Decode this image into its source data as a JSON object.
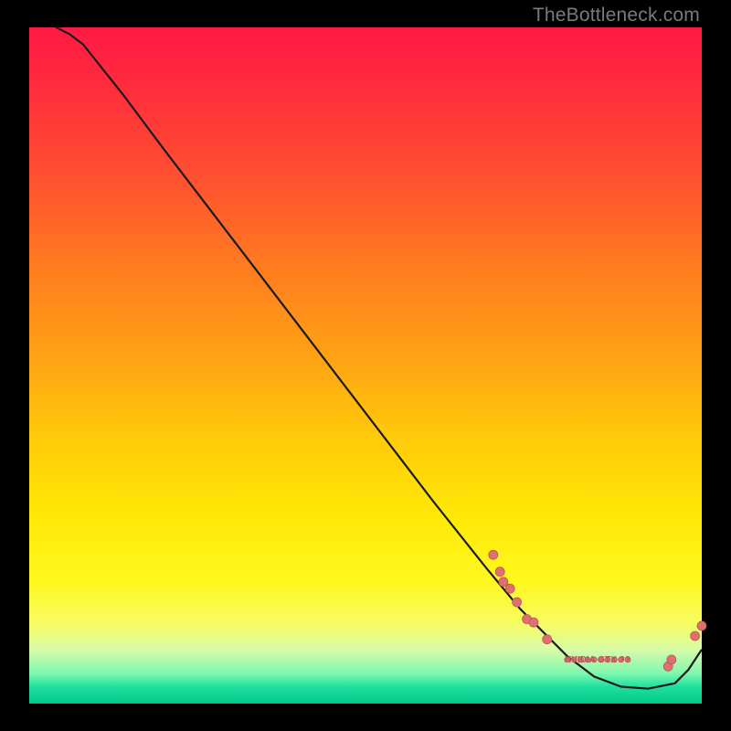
{
  "watermark": "TheBottleneck.com",
  "colors": {
    "background": "#000000",
    "curve": "#1a1a1a",
    "marker_fill": "#e07070",
    "marker_stroke": "#b85858",
    "label_text": "#b85858"
  },
  "chart_data": {
    "type": "line",
    "title": "",
    "xlabel": "",
    "ylabel": "",
    "xlim": [
      0,
      100
    ],
    "ylim": [
      0,
      100
    ],
    "grid": false,
    "curve": {
      "name": "bottleneck-curve",
      "x": [
        4,
        6,
        8,
        10,
        14,
        20,
        30,
        40,
        50,
        60,
        68,
        73,
        76,
        80,
        84,
        88,
        92,
        96,
        98,
        100
      ],
      "y": [
        100,
        99,
        97.5,
        95,
        90,
        82,
        69,
        56,
        43,
        30,
        20,
        14,
        11,
        7,
        4,
        2.5,
        2.2,
        3,
        5,
        8
      ]
    },
    "marker_clusters": [
      {
        "name": "upper-scatter",
        "points": [
          {
            "x": 69,
            "y": 22
          },
          {
            "x": 70,
            "y": 19.5
          },
          {
            "x": 70.5,
            "y": 18
          },
          {
            "x": 71.5,
            "y": 17
          },
          {
            "x": 72.5,
            "y": 15
          },
          {
            "x": 74,
            "y": 12.5
          },
          {
            "x": 75,
            "y": 12
          },
          {
            "x": 77,
            "y": 9.5
          }
        ]
      },
      {
        "name": "valley-label-cluster",
        "label_glyph": "NVIDIA GTX ??",
        "points": [
          {
            "x": 80,
            "y": 6.5
          },
          {
            "x": 81,
            "y": 6.5
          },
          {
            "x": 82,
            "y": 6.5
          },
          {
            "x": 83,
            "y": 6.5
          },
          {
            "x": 84,
            "y": 6.5
          },
          {
            "x": 85,
            "y": 6.5
          },
          {
            "x": 86,
            "y": 6.5
          },
          {
            "x": 87,
            "y": 6.5
          },
          {
            "x": 88,
            "y": 6.5
          },
          {
            "x": 89,
            "y": 6.5
          }
        ]
      },
      {
        "name": "right-tail",
        "points": [
          {
            "x": 95,
            "y": 5.5
          },
          {
            "x": 95.5,
            "y": 6.5
          },
          {
            "x": 99,
            "y": 10
          },
          {
            "x": 100,
            "y": 11.5
          }
        ]
      }
    ]
  }
}
